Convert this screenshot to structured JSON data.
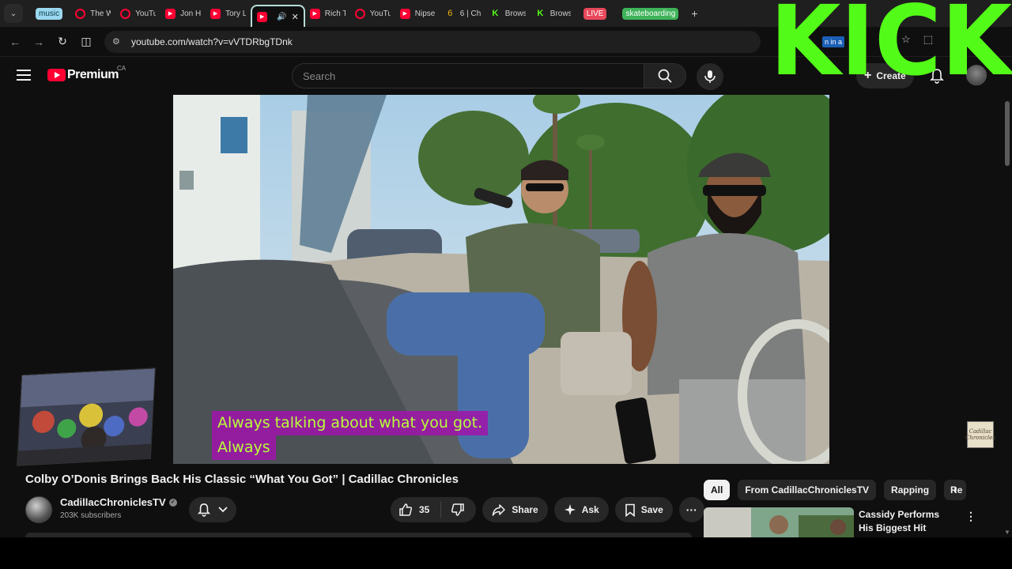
{
  "browser": {
    "tabs": [
      {
        "title": "music",
        "type": "pill",
        "pill_bg": "#9ad8f0",
        "pill_fg": "#0a3a4a"
      },
      {
        "title": "The W",
        "icon": "youtube-ring-icon"
      },
      {
        "title": "YouTu",
        "icon": "youtube-ring-icon"
      },
      {
        "title": "Jon Ho",
        "icon": "youtube-icon"
      },
      {
        "title": "Tory L",
        "icon": "youtube-icon"
      },
      {
        "title": "",
        "icon": "youtube-icon",
        "active": true
      },
      {
        "title": "Rich T",
        "icon": "youtube-icon"
      },
      {
        "title": "YouTu",
        "icon": "youtube-ring-icon"
      },
      {
        "title": "Nipse",
        "icon": "youtube-icon"
      },
      {
        "title": "6 | Cha",
        "icon": "six-icon"
      },
      {
        "title": "Brows",
        "icon": "kick-icon"
      },
      {
        "title": "Brows",
        "icon": "kick-icon"
      },
      {
        "title": "LIVE",
        "type": "pill",
        "pill_bg": "#e8485a",
        "pill_fg": "#ffffff"
      },
      {
        "title": "skateboarding",
        "type": "pill",
        "pill_bg": "#3fb35a",
        "pill_fg": "#ffffff"
      }
    ],
    "url": "youtube.com/watch?v=vVTDRbgTDnk",
    "signin_chip": "n in a",
    "new_tab": "+"
  },
  "masthead": {
    "logo_word": "Premium",
    "country": "CA",
    "search_placeholder": "Search",
    "create_label": "Create"
  },
  "overlay": {
    "text": "KICK",
    "color": "#53fc18"
  },
  "player": {
    "subtitle_line1": "Always talking about what you got.",
    "subtitle_line2": "Always",
    "corner_logo": "Cadillac Chronicles"
  },
  "video": {
    "title": "Colby O’Donis Brings Back His Classic “What You Got” | Cadillac Chronicles",
    "channel": "CadillacChroniclesTV",
    "subscribers": "203K subscribers",
    "likes": "35",
    "share_label": "Share",
    "ask_label": "Ask",
    "save_label": "Save"
  },
  "sidebar": {
    "chips": [
      "All",
      "From CadillacChroniclesTV",
      "Rapping",
      "Re"
    ],
    "rec_title": "Cassidy Performs His Biggest Hit “Hotel” ..."
  },
  "colors": {
    "accent": "#ff0033",
    "kick_green": "#53fc18",
    "subtitle_bg": "#a014aa",
    "subtitle_fg": "#b8ff3a"
  }
}
